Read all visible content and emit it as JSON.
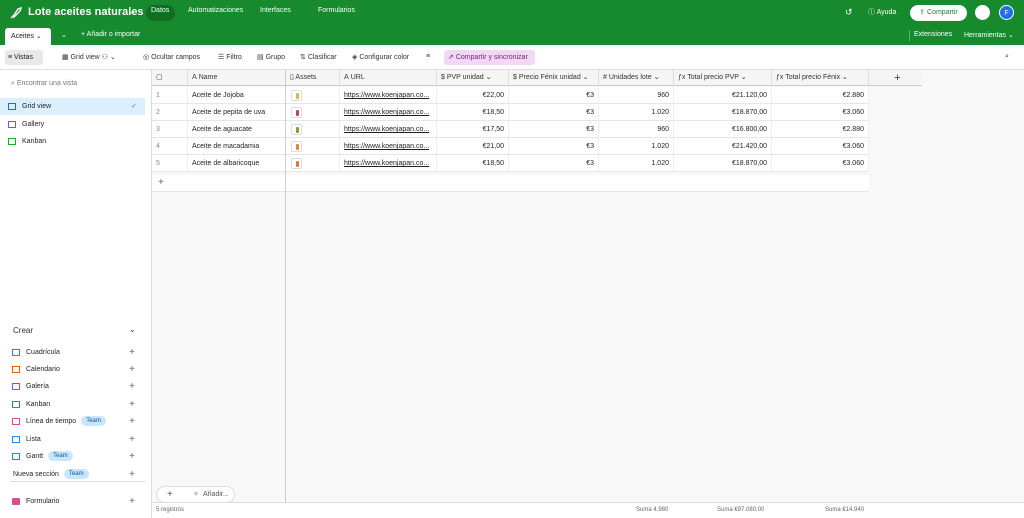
{
  "top": {
    "base_title": "Lote aceites naturales",
    "nav": [
      "Datos",
      "Automatizaciones",
      "Interfaces",
      "Formularios"
    ],
    "help": "Ayuda",
    "share": "Compartir",
    "avatar": "F"
  },
  "tabs": {
    "active": "Aceites",
    "add": "Añadir o importar",
    "extensions": "Extensiones",
    "tools": "Herramientas"
  },
  "toolbar": {
    "views": "Vistas",
    "grid_view": "Grid view",
    "hide": "Ocultar campos",
    "filter": "Filtro",
    "group": "Grupo",
    "sort": "Clasificar",
    "color": "Configurar color",
    "sync": "Compartir y sincronizar"
  },
  "sidebar": {
    "search_placeholder": "Encontrar una vista",
    "views": [
      "Grid view",
      "Gallery",
      "Kanban"
    ],
    "create_title": "Crear",
    "create": [
      {
        "label": "Cuadrícula",
        "team": ""
      },
      {
        "label": "Calendario",
        "team": ""
      },
      {
        "label": "Galería",
        "team": ""
      },
      {
        "label": "Kanban",
        "team": ""
      },
      {
        "label": "Línea de tiempo",
        "team": "Team"
      },
      {
        "label": "Lista",
        "team": ""
      },
      {
        "label": "Gantt",
        "team": "Team"
      }
    ],
    "new_section": "Nueva sección",
    "new_section_badge": "Team",
    "form": "Formulario"
  },
  "columns": [
    "Name",
    "Assets",
    "URL",
    "PVP unidad",
    "Precio Fénix unidad",
    "Unidades lote",
    "Total precio PVP",
    "Total precio Fénix"
  ],
  "rows": [
    {
      "n": "1",
      "name": "Aceite de Jojoba",
      "url": "https://www.koenjapan.co...",
      "pvp": "€22,00",
      "fenix": "€3",
      "units": "960",
      "tpvp": "€21.120,00",
      "tfenix": "€2.880"
    },
    {
      "n": "2",
      "name": "Aceite de pepita de uva",
      "url": "https://www.koenjapan.co...",
      "pvp": "€18,50",
      "fenix": "€3",
      "units": "1.020",
      "tpvp": "€18.870,00",
      "tfenix": "€3.060"
    },
    {
      "n": "3",
      "name": "Aceite de aguacate",
      "url": "https://www.koenjapan.co...",
      "pvp": "€17,50",
      "fenix": "€3",
      "units": "960",
      "tpvp": "€16.800,00",
      "tfenix": "€2.880"
    },
    {
      "n": "4",
      "name": "Aceite de macadamia",
      "url": "https://www.koenjapan.co...",
      "pvp": "€21,00",
      "fenix": "€3",
      "units": "1.020",
      "tpvp": "€21.420,00",
      "tfenix": "€3.060"
    },
    {
      "n": "5",
      "name": "Aceite de albaricoque",
      "url": "https://www.koenjapan.co...",
      "pvp": "€18,50",
      "fenix": "€3",
      "units": "1.020",
      "tpvp": "€18.870,00",
      "tfenix": "€3.060"
    }
  ],
  "footer": {
    "records": "5 registros",
    "sum_units": "Suma 4.980",
    "sum_pvp": "Suma €97.080,00",
    "sum_fenix": "Suma €14.940",
    "add_label": "Añadir..."
  }
}
